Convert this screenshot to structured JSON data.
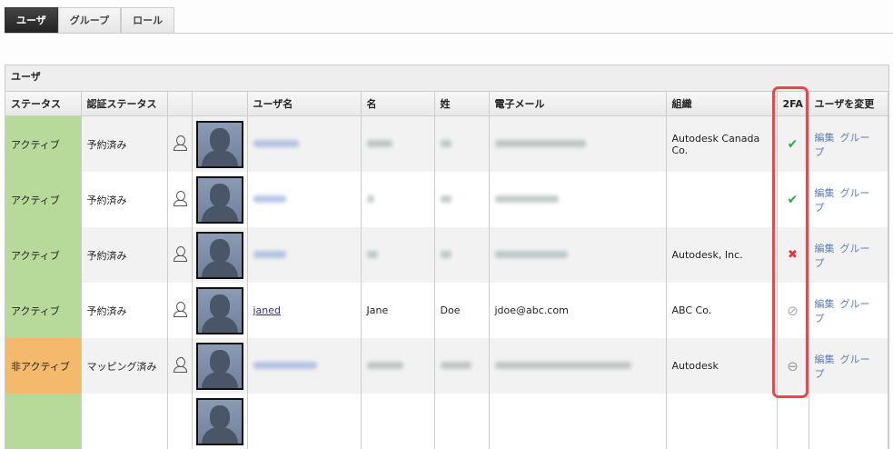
{
  "tabs": [
    "ユーザ",
    "グループ",
    "ロール"
  ],
  "panel_title": "ユーザ",
  "columns": [
    "ステータス",
    "認証ステータス",
    "",
    "",
    "ユーザ名",
    "名",
    "姓",
    "電子メール",
    "組織",
    "2FA",
    "ユーザを変更"
  ],
  "actions": {
    "edit": "編集",
    "group": "グループ"
  },
  "rows": [
    {
      "status": "アクティブ",
      "auth": "予約済み",
      "username": "",
      "first": "",
      "last": "",
      "email": "",
      "org": "Autodesk Canada Co.",
      "twofa": "enabled",
      "icon": "user-icon"
    },
    {
      "status": "アクティブ",
      "auth": "予約済み",
      "username": "",
      "first": "",
      "last": "",
      "email": "",
      "org": "",
      "twofa": "enabled",
      "icon": "user-icon"
    },
    {
      "status": "アクティブ",
      "auth": "予約済み",
      "username": "",
      "first": "",
      "last": "",
      "email": "",
      "org": "Autodesk, Inc.",
      "twofa": "disabled",
      "icon": "user-icon"
    },
    {
      "status": "アクティブ",
      "auth": "予約済み",
      "username": "janed",
      "first": "Jane",
      "last": "Doe",
      "email": "jdoe@abc.com",
      "org": "ABC Co.",
      "twofa": "not-applicable",
      "icon": "user-transfer-icon"
    },
    {
      "status": "非アクティブ",
      "auth": "マッピング済み",
      "username": "",
      "first": "",
      "last": "",
      "email": "",
      "org": "Autodesk",
      "twofa": "unavailable",
      "icon": "user-icon"
    }
  ],
  "colors": {
    "active": "#b7d99a",
    "inactive": "#f5b96b",
    "check": "#2aa84a",
    "cross": "#e8333a",
    "highlight": "#f0434a"
  }
}
